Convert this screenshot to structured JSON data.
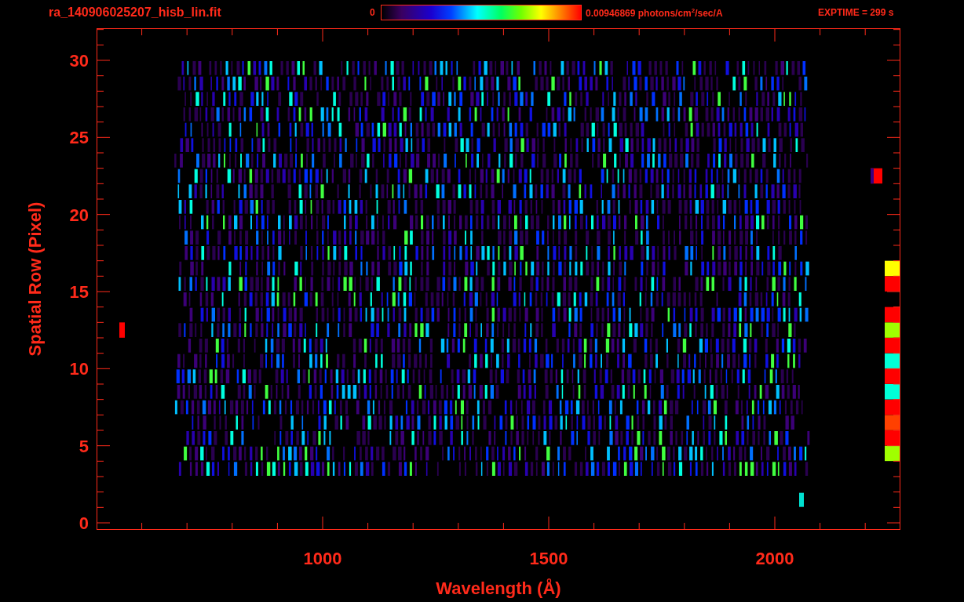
{
  "header": {
    "filename": "ra_140906025207_hisb_lin.fit",
    "colorbar_min": "0",
    "colorbar_max": "0.00946869 photons/cm$^{2}$/sec/A",
    "exptime": "EXPTIME = 299 s"
  },
  "plot": {
    "ylabel": "Spatial Row (Pixel)",
    "xlabel": "Wavelength (Å)",
    "yticks": [
      "30",
      "25",
      "20",
      "15",
      "10",
      "5",
      "0"
    ],
    "xticks": [
      "1000",
      "1500",
      "2000"
    ]
  }
}
